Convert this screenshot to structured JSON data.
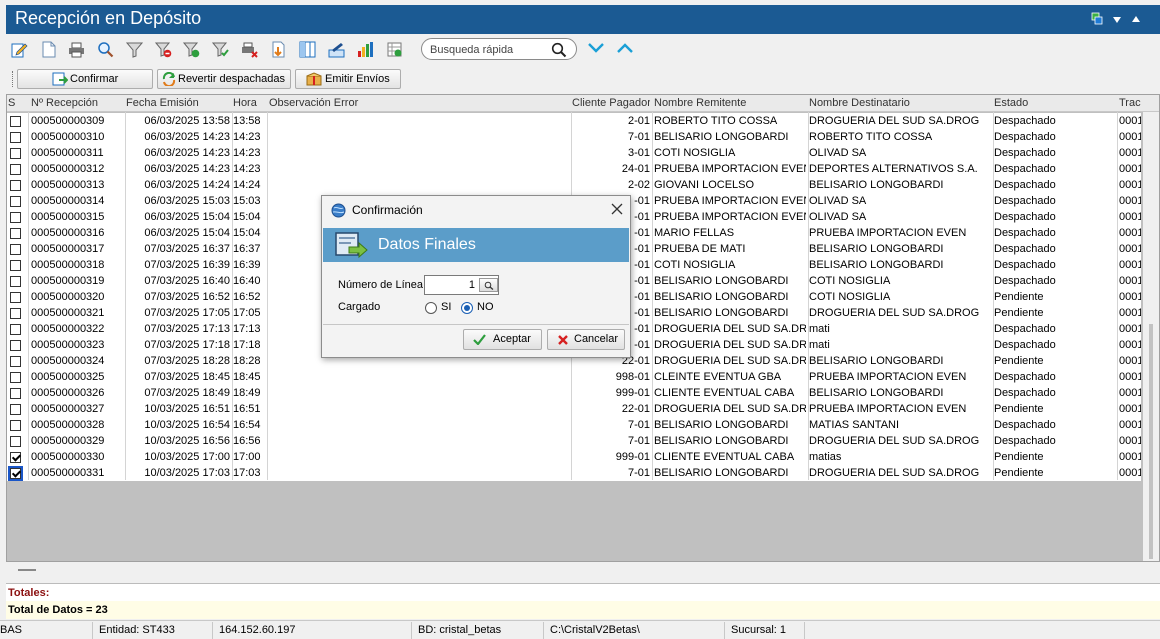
{
  "window": {
    "title": "Recepción en Depósito"
  },
  "search": {
    "placeholder": "Busqueda rápida"
  },
  "actions": {
    "confirmar": "Confirmar",
    "revertir": "Revertir despachadas",
    "emitir": "Emitir Envíos"
  },
  "columns": [
    "S",
    "Nº Recepción",
    "Fecha Emisión",
    "Hora",
    "Observación Error",
    "Cliente Pagador",
    "Nombre Remitente",
    "Nombre Destinatario",
    "Estado",
    "Track"
  ],
  "rows": [
    {
      "checked": false,
      "num": "000500000309",
      "fecha": "06/03/2025 13:58",
      "hora": "13:58",
      "obs": "",
      "cliente": "2-01",
      "remitente": "ROBERTO TITO COSSA",
      "destinatario": "DROGUERIA DEL SUD SA.DROG",
      "estado": "Despachado",
      "track": "0001"
    },
    {
      "checked": false,
      "num": "000500000310",
      "fecha": "06/03/2025 14:23",
      "hora": "14:23",
      "obs": "",
      "cliente": "7-01",
      "remitente": "BELISARIO LONGOBARDI",
      "destinatario": "ROBERTO TITO COSSA",
      "estado": "Despachado",
      "track": "0001"
    },
    {
      "checked": false,
      "num": "000500000311",
      "fecha": "06/03/2025 14:23",
      "hora": "14:23",
      "obs": "",
      "cliente": "3-01",
      "remitente": "COTI NOSIGLIA",
      "destinatario": "OLIVAD SA",
      "estado": "Despachado",
      "track": "0001"
    },
    {
      "checked": false,
      "num": "000500000312",
      "fecha": "06/03/2025 14:23",
      "hora": "14:23",
      "obs": "",
      "cliente": "24-01",
      "remitente": "PRUEBA IMPORTACION EVEN",
      "destinatario": "DEPORTES ALTERNATIVOS S.A.",
      "estado": "Despachado",
      "track": "0001"
    },
    {
      "checked": false,
      "num": "000500000313",
      "fecha": "06/03/2025 14:24",
      "hora": "14:24",
      "obs": "",
      "cliente": "2-02",
      "remitente": "GIOVANI LOCELSO",
      "destinatario": "BELISARIO LONGOBARDI",
      "estado": "Despachado",
      "track": "0001"
    },
    {
      "checked": false,
      "num": "000500000314",
      "fecha": "06/03/2025 15:03",
      "hora": "15:03",
      "obs": "",
      "cliente": "-01",
      "remitente": "PRUEBA IMPORTACION EVEN",
      "destinatario": "OLIVAD SA",
      "estado": "Despachado",
      "track": "0001"
    },
    {
      "checked": false,
      "num": "000500000315",
      "fecha": "06/03/2025 15:04",
      "hora": "15:04",
      "obs": "",
      "cliente": "-01",
      "remitente": "PRUEBA IMPORTACION EVEN",
      "destinatario": "OLIVAD SA",
      "estado": "Despachado",
      "track": "0001"
    },
    {
      "checked": false,
      "num": "000500000316",
      "fecha": "06/03/2025 15:04",
      "hora": "15:04",
      "obs": "",
      "cliente": "-01",
      "remitente": "MARIO FELLAS",
      "destinatario": "PRUEBA IMPORTACION EVEN",
      "estado": "Despachado",
      "track": "0001"
    },
    {
      "checked": false,
      "num": "000500000317",
      "fecha": "07/03/2025 16:37",
      "hora": "16:37",
      "obs": "",
      "cliente": "-01",
      "remitente": "PRUEBA DE MATI",
      "destinatario": "BELISARIO LONGOBARDI",
      "estado": "Despachado",
      "track": "0001"
    },
    {
      "checked": false,
      "num": "000500000318",
      "fecha": "07/03/2025 16:39",
      "hora": "16:39",
      "obs": "",
      "cliente": "-01",
      "remitente": "COTI NOSIGLIA",
      "destinatario": "BELISARIO LONGOBARDI",
      "estado": "Despachado",
      "track": "0001"
    },
    {
      "checked": false,
      "num": "000500000319",
      "fecha": "07/03/2025 16:40",
      "hora": "16:40",
      "obs": "",
      "cliente": "-01",
      "remitente": "BELISARIO LONGOBARDI",
      "destinatario": "COTI NOSIGLIA",
      "estado": "Despachado",
      "track": "0001"
    },
    {
      "checked": false,
      "num": "000500000320",
      "fecha": "07/03/2025 16:52",
      "hora": "16:52",
      "obs": "",
      "cliente": "-01",
      "remitente": "BELISARIO LONGOBARDI",
      "destinatario": "COTI NOSIGLIA",
      "estado": "Pendiente",
      "track": "0001"
    },
    {
      "checked": false,
      "num": "000500000321",
      "fecha": "07/03/2025 17:05",
      "hora": "17:05",
      "obs": "",
      "cliente": "-01",
      "remitente": "BELISARIO LONGOBARDI",
      "destinatario": "DROGUERIA DEL SUD SA.DROG",
      "estado": "Pendiente",
      "track": "0001"
    },
    {
      "checked": false,
      "num": "000500000322",
      "fecha": "07/03/2025 17:13",
      "hora": "17:13",
      "obs": "",
      "cliente": "-01",
      "remitente": "DROGUERIA DEL SUD SA.DROG",
      "destinatario": "mati",
      "estado": "Despachado",
      "track": "0001"
    },
    {
      "checked": false,
      "num": "000500000323",
      "fecha": "07/03/2025 17:18",
      "hora": "17:18",
      "obs": "",
      "cliente": "-01",
      "remitente": "DROGUERIA DEL SUD SA.DROG",
      "destinatario": "mati",
      "estado": "Despachado",
      "track": "0001"
    },
    {
      "checked": false,
      "num": "000500000324",
      "fecha": "07/03/2025 18:28",
      "hora": "18:28",
      "obs": "",
      "cliente": "22-01",
      "remitente": "DROGUERIA DEL SUD SA.DROG",
      "destinatario": "BELISARIO LONGOBARDI",
      "estado": "Pendiente",
      "track": "0001"
    },
    {
      "checked": false,
      "num": "000500000325",
      "fecha": "07/03/2025 18:45",
      "hora": "18:45",
      "obs": "",
      "cliente": "998-01",
      "remitente": "CLEINTE EVENTUA GBA",
      "destinatario": "PRUEBA IMPORTACION EVEN",
      "estado": "Despachado",
      "track": "0001"
    },
    {
      "checked": false,
      "num": "000500000326",
      "fecha": "07/03/2025 18:49",
      "hora": "18:49",
      "obs": "",
      "cliente": "999-01",
      "remitente": "CLIENTE EVENTUAL CABA",
      "destinatario": "BELISARIO LONGOBARDI",
      "estado": "Despachado",
      "track": "0001"
    },
    {
      "checked": false,
      "num": "000500000327",
      "fecha": "10/03/2025 16:51",
      "hora": "16:51",
      "obs": "",
      "cliente": "22-01",
      "remitente": "DROGUERIA DEL SUD SA.DROG",
      "destinatario": "PRUEBA IMPORTACION EVEN",
      "estado": "Pendiente",
      "track": "0001"
    },
    {
      "checked": false,
      "num": "000500000328",
      "fecha": "10/03/2025 16:54",
      "hora": "16:54",
      "obs": "",
      "cliente": "7-01",
      "remitente": "BELISARIO LONGOBARDI",
      "destinatario": "MATIAS SANTANI",
      "estado": "Despachado",
      "track": "0001"
    },
    {
      "checked": false,
      "num": "000500000329",
      "fecha": "10/03/2025 16:56",
      "hora": "16:56",
      "obs": "",
      "cliente": "7-01",
      "remitente": "BELISARIO LONGOBARDI",
      "destinatario": "DROGUERIA DEL SUD SA.DROG",
      "estado": "Despachado",
      "track": "0001"
    },
    {
      "checked": true,
      "num": "000500000330",
      "fecha": "10/03/2025 17:00",
      "hora": "17:00",
      "obs": "",
      "cliente": "999-01",
      "remitente": "CLIENTE EVENTUAL CABA",
      "destinatario": "matias",
      "estado": "Pendiente",
      "track": "0001"
    },
    {
      "checked": true,
      "selected": true,
      "num": "000500000331",
      "fecha": "10/03/2025 17:03",
      "hora": "17:03",
      "obs": "",
      "cliente": "7-01",
      "remitente": "BELISARIO LONGOBARDI",
      "destinatario": "DROGUERIA DEL SUD SA.DROG",
      "estado": "Pendiente",
      "track": "0001"
    }
  ],
  "totals": {
    "label": "Totales:",
    "total_datos": "Total de Datos = 23"
  },
  "status": {
    "app": "BAS",
    "entidad": "Entidad: ST433",
    "ip": "164.152.60.197",
    "bd": "BD: cristal_betas",
    "path": "C:\\CristalV2Betas\\",
    "sucursal": "Sucursal: 1"
  },
  "dialog": {
    "title": "Confirmación",
    "banner": "Datos Finales",
    "numero_linea_label": "Número de Línea",
    "numero_linea_value": "1",
    "cargado_label": "Cargado",
    "si_label": "SI",
    "no_label": "NO",
    "cargado_value": "NO",
    "aceptar": "Aceptar",
    "cancelar": "Cancelar"
  },
  "colors": {
    "title_bar": "#1b5a93",
    "banner": "#5b9dc9",
    "accent": "#1a9fd6",
    "totals_label": "#8b1010"
  }
}
